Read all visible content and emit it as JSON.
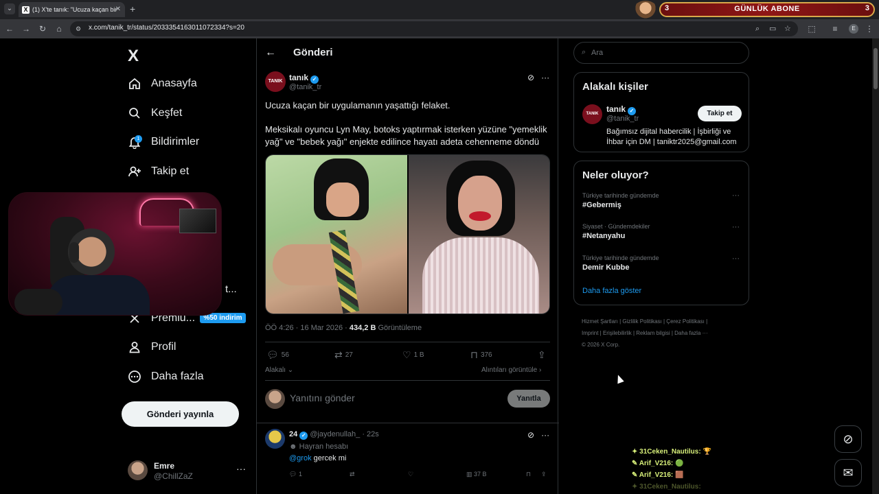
{
  "browser": {
    "tab_title": "(1) X'te tanık: \"Ucuza kaçan bir",
    "url": "x.com/tanik_tr/status/2033354163011072334?s=20"
  },
  "stream_banner": {
    "left_count": "3",
    "label": "GÜNLÜK ABONE",
    "right_count": "3"
  },
  "nav": {
    "logo": "X",
    "items": [
      {
        "label": "Anasayfa",
        "icon": "home-icon"
      },
      {
        "label": "Keşfet",
        "icon": "search-icon"
      },
      {
        "label": "Bildirimler",
        "icon": "bell-icon",
        "badge": "1"
      },
      {
        "label": "Takip et",
        "icon": "follow-icon"
      },
      {
        "label": "t...",
        "icon": "more-icon"
      },
      {
        "label": "Premiu...",
        "icon": "x-premium-icon"
      },
      {
        "label": "Profil",
        "icon": "profile-icon"
      },
      {
        "label": "Daha fazla",
        "icon": "more-circle-icon"
      }
    ],
    "premium_badge": "%50 indirim",
    "post_button": "Gönderi yayınla",
    "user": {
      "name": "Emre",
      "handle": "@ChillZaZ"
    }
  },
  "post": {
    "header_title": "Gönderi",
    "author": {
      "name": "tanık",
      "handle": "@tanik_tr",
      "avatar_text": "TANIK"
    },
    "text_line1": "Ucuza kaçan bir uygulamanın yaşattığı felaket.",
    "text_line2": "Meksikalı oyuncu Lyn May, botoks yaptırmak isterken yüzüne \"yemeklik yağ\" ve \"bebek yağı\" enjekte edilince hayatı adeta cehenneme döndü",
    "timestamp": "ÖÖ 4:26 · 16 Mar 2026 · ",
    "views": "434,2 B",
    "views_label": " Görüntüleme",
    "stats": {
      "replies": "56",
      "reposts": "27",
      "likes": "1 B",
      "bookmarks": "376"
    },
    "related_label": "Alakalı",
    "quotes_label": "Alıntıları görüntüle",
    "reply_placeholder": "Yanıtını gönder",
    "reply_button": "Yanıtla"
  },
  "reply": {
    "name": "24",
    "handle": "@jaydenullah_",
    "time": "22s",
    "fan_label": "Hayran hesabı",
    "mention": "@grok",
    "text": " gercek mi",
    "stats": {
      "replies": "1",
      "views": "37 B"
    }
  },
  "sidebar": {
    "search_placeholder": "Ara",
    "related_title": "Alakalı kişiler",
    "related_person": {
      "name": "tanık",
      "handle": "@tanik_tr",
      "avatar_text": "TANIK",
      "bio": "Bağımsız dijital habercilik | İşbirliği ve İhbar için DM | taniktr2025@gmail.com",
      "follow_label": "Takip et"
    },
    "trends_title": "Neler oluyor?",
    "trends": [
      {
        "context": "Türkiye tarihinde gündemde",
        "name": "#Gebermiş"
      },
      {
        "context": "Siyaset · Gündemdekiler",
        "name": "#Netanyahu"
      },
      {
        "context": "Türkiye tarihinde gündemde",
        "name": "Demir Kubbe"
      }
    ],
    "show_more": "Daha fazla göster",
    "footer_line1": "Hizmet Şartları  |  Gizlilik Politikası  |  Çerez Politikası  |",
    "footer_line2": "Imprint  |  Erişilebilirlik  |  Reklam bilgisi  |  Daha fazla ···",
    "footer_line3": "© 2026 X Corp."
  },
  "chat": [
    {
      "user": "31Ceken_Nautilus:",
      "msg": "🏆"
    },
    {
      "user": "Arif_V216:",
      "msg": "🟢"
    },
    {
      "user": "Arif_V216:",
      "msg": "🟫"
    },
    {
      "user": "31Ceken_Nautilus:",
      "msg": ""
    }
  ],
  "colors": {
    "accent": "#1d9bf0",
    "background": "#000000",
    "banner": "#8f1616"
  }
}
